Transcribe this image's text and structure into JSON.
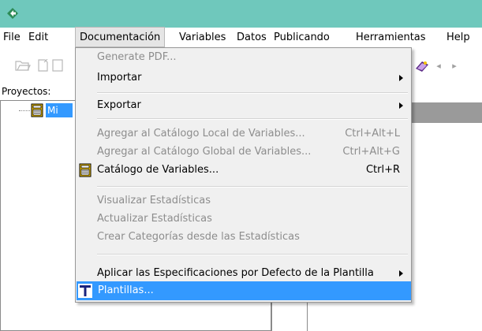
{
  "menubar": {
    "items": [
      "File",
      "Edit",
      "Documentación",
      "Variables",
      "Datos",
      "Publicando",
      "Herramientas",
      "Help"
    ]
  },
  "sidebar": {
    "label": "Proyectos:",
    "selected_item": "Mi"
  },
  "dropdown": {
    "items": [
      {
        "label": "Generate PDF...",
        "shortcut": "",
        "disabled": true,
        "submenu": false
      },
      {
        "label": "Importar",
        "shortcut": "",
        "disabled": false,
        "submenu": true
      },
      {
        "label": "Exportar",
        "shortcut": "",
        "disabled": false,
        "submenu": true
      },
      {
        "label": "Agregar al Catálogo Local de Variables...",
        "shortcut": "Ctrl+Alt+L",
        "disabled": true,
        "submenu": false
      },
      {
        "label": "Agregar al Catálogo Global de Variables...",
        "shortcut": "Ctrl+Alt+G",
        "disabled": true,
        "submenu": false
      },
      {
        "label": "Catálogo de Variables...",
        "shortcut": "Ctrl+R",
        "disabled": false,
        "submenu": false,
        "icon": "catalog-icon"
      },
      {
        "label": "Visualizar Estadísticas",
        "shortcut": "",
        "disabled": true,
        "submenu": false
      },
      {
        "label": "Actualizar Estadísticas",
        "shortcut": "",
        "disabled": true,
        "submenu": false
      },
      {
        "label": "Crear Categorías desde las Estadísticas",
        "shortcut": "",
        "disabled": true,
        "submenu": false
      },
      {
        "label": "Aplicar las Especificaciones por Defecto de la Plantilla",
        "shortcut": "",
        "disabled": false,
        "submenu": true
      },
      {
        "label": "Plantillas...",
        "shortcut": "",
        "disabled": false,
        "submenu": false,
        "highlighted": true,
        "icon": "template-t-icon"
      }
    ]
  },
  "colors": {
    "titlebar": "#6fc8bc",
    "highlight": "#3399ff",
    "menu_bg": "#f0f0f0"
  }
}
